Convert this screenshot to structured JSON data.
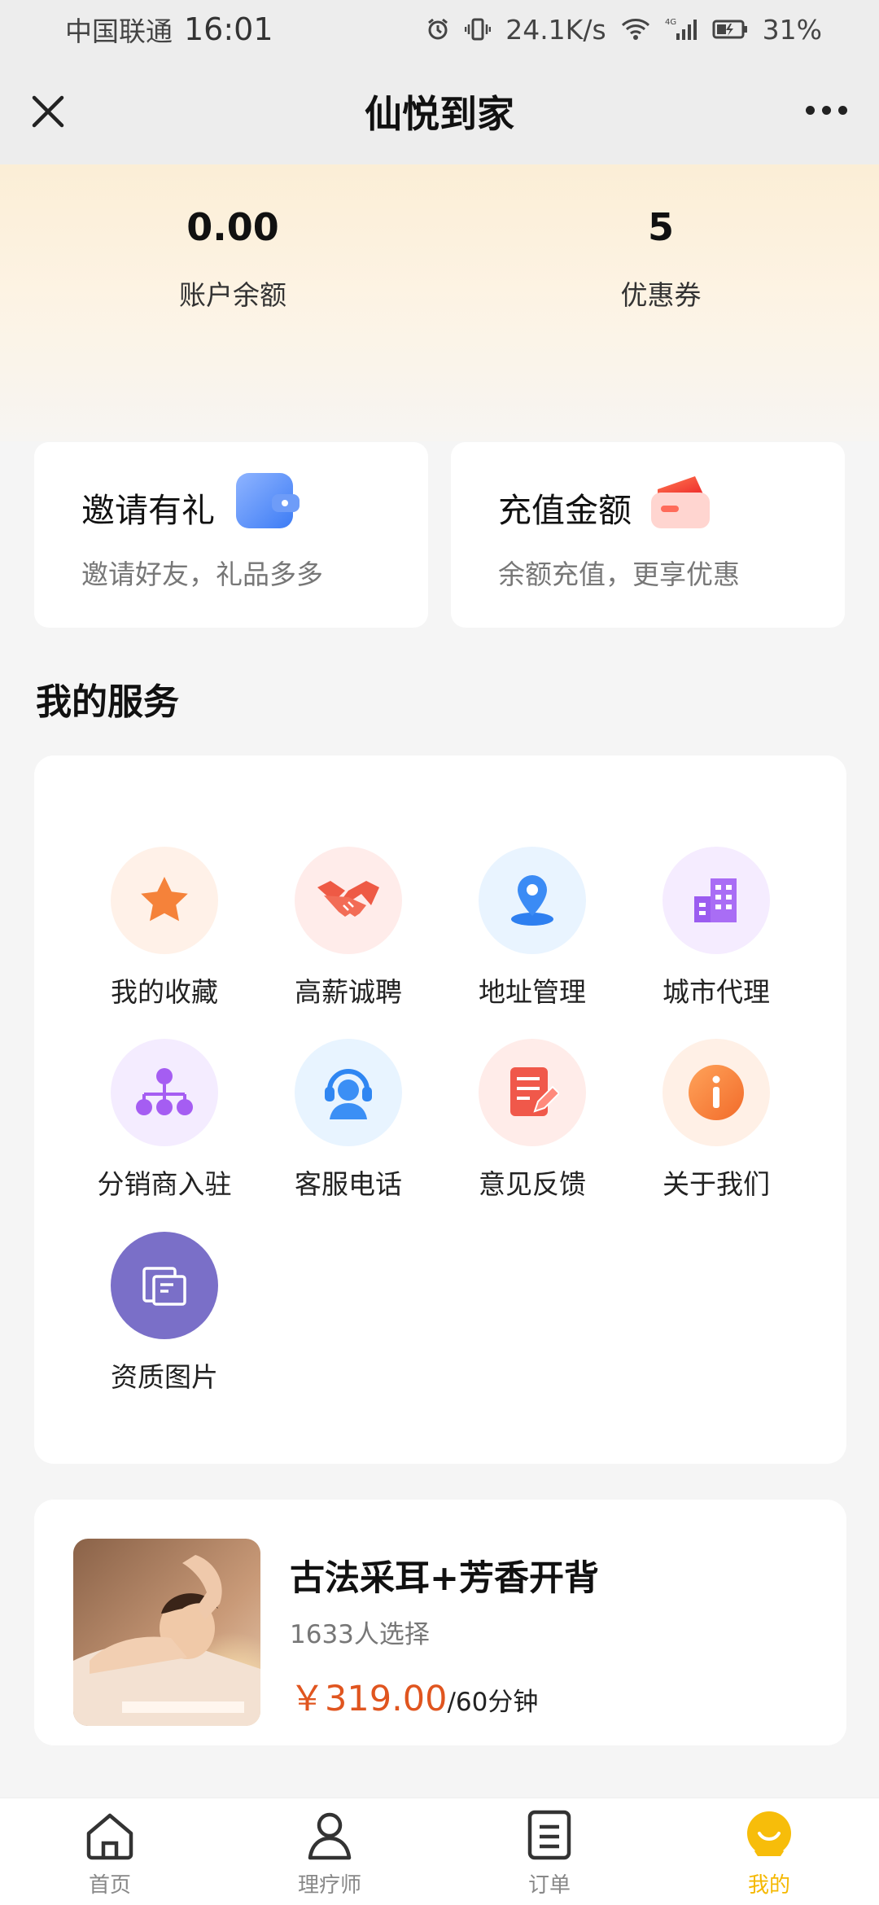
{
  "status_bar": {
    "carrier": "中国联通",
    "time": "16:01",
    "net_speed": "24.1K/s",
    "network": "4G",
    "battery": "31%"
  },
  "nav": {
    "title": "仙悦到家"
  },
  "stats": {
    "balance_value": "0.00",
    "balance_label": "账户余额",
    "coupon_value": "5",
    "coupon_label": "优惠券"
  },
  "promos": {
    "invite_title": "邀请有礼",
    "invite_sub": "邀请好友，礼品多多",
    "recharge_title": "充值金额",
    "recharge_sub": "余额充值，更享优惠"
  },
  "services": {
    "title": "我的服务",
    "items": [
      {
        "label": "我的收藏",
        "icon": "star-icon"
      },
      {
        "label": "高薪诚聘",
        "icon": "handshake-icon"
      },
      {
        "label": "地址管理",
        "icon": "location-pin-icon"
      },
      {
        "label": "城市代理",
        "icon": "building-icon"
      },
      {
        "label": "分销商入驻",
        "icon": "org-chart-icon"
      },
      {
        "label": "客服电话",
        "icon": "headset-icon"
      },
      {
        "label": "意见反馈",
        "icon": "feedback-icon"
      },
      {
        "label": "关于我们",
        "icon": "info-icon"
      },
      {
        "label": "资质图片",
        "icon": "certificate-icon"
      }
    ]
  },
  "product": {
    "title": "古法采耳+芳香开背",
    "count": "1633人选择",
    "price": "￥319.00",
    "unit": "/60分钟"
  },
  "tabbar": {
    "tabs": [
      {
        "label": "首页",
        "icon": "home-icon"
      },
      {
        "label": "理疗师",
        "icon": "person-icon"
      },
      {
        "label": "订单",
        "icon": "order-list-icon"
      },
      {
        "label": "我的",
        "icon": "profile-face-icon"
      }
    ],
    "active_index": 3,
    "active_color": "#f5b800"
  },
  "colors": {
    "price": "#e0551f",
    "accent": "#f5b800"
  }
}
